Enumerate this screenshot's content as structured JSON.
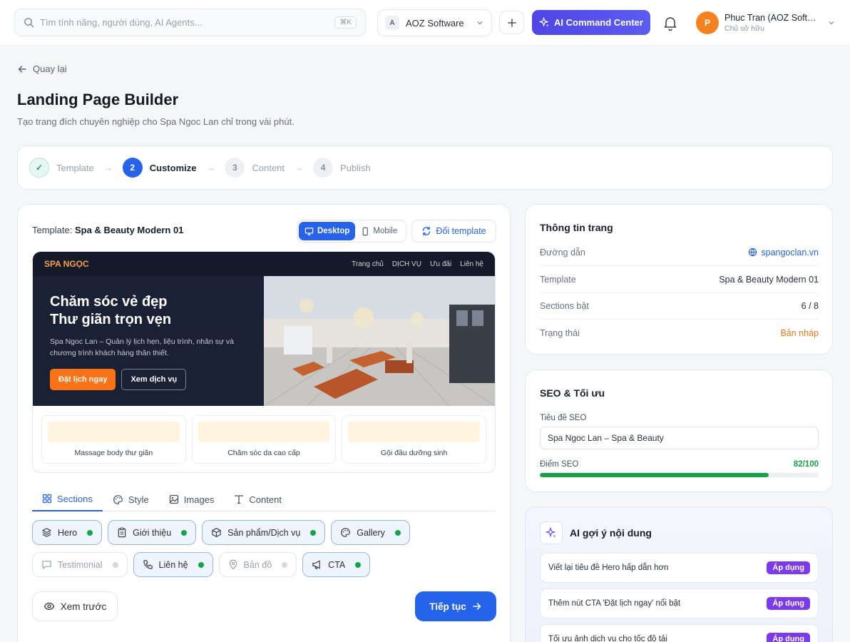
{
  "topbar": {
    "search_placeholder": "Tìm tính năng, người dùng, AI Agents...",
    "search_shortcut": "⌘K",
    "org_mark": "A",
    "org_name": "AOZ Software",
    "ai_button": "AI Command Center",
    "user_initial": "P",
    "user_name": "Phuc Tran (AOZ Software)",
    "user_role": "Chủ sở hữu"
  },
  "header": {
    "back": "Quay lại",
    "title": "Landing Page Builder",
    "subtitle": "Tạo trang đích chuyên nghiệp cho Spa Ngoc Lan chỉ trong vài phút."
  },
  "stepper": [
    {
      "num": "✓",
      "label": "Template",
      "state": "done"
    },
    {
      "num": "2",
      "label": "Customize",
      "state": "active"
    },
    {
      "num": "3",
      "label": "Content",
      "state": "todo"
    },
    {
      "num": "4",
      "label": "Publish",
      "state": "todo"
    }
  ],
  "builder": {
    "template_prefix": "Template:",
    "template_name": "Spa & Beauty Modern 01",
    "device_desktop": "Desktop",
    "device_mobile": "Mobile",
    "swap_template": "Đổi template",
    "preview": {
      "brand": "SPA NGỌC",
      "nav": [
        "Trang chủ",
        "DỊCH VỤ",
        "Ưu đãi",
        "Liên hệ"
      ],
      "hero_title_1": "Chăm sóc vẻ đẹp",
      "hero_title_2": "Thư giãn trọn vẹn",
      "hero_desc": "Spa Ngoc Lan – Quản lý lịch hẹn, liệu trình, nhân sự và chương trình khách hàng thân thiết.",
      "btn_primary": "Đặt lịch ngay",
      "btn_secondary": "Xem dịch vụ",
      "cards": [
        "Massage body thư giãn",
        "Chăm sóc da cao cấp",
        "Gội đầu dưỡng sinh"
      ]
    },
    "tabs": [
      "Sections",
      "Style",
      "Images",
      "Content"
    ],
    "sections_row1": [
      {
        "label": "Hero",
        "icon": "layers-icon",
        "on": true
      },
      {
        "label": "Giới thiệu",
        "icon": "clipboard-icon",
        "on": true
      },
      {
        "label": "Sản phẩm/Dịch vụ",
        "icon": "box-icon",
        "on": true
      },
      {
        "label": "Gallery",
        "icon": "palette-icon",
        "on": true
      }
    ],
    "sections_row2": [
      {
        "label": "Testimonial",
        "icon": "message-icon",
        "on": false
      },
      {
        "label": "Liên hệ",
        "icon": "phone-icon",
        "on": true
      },
      {
        "label": "Bản đồ",
        "icon": "map-pin-icon",
        "on": false
      },
      {
        "label": "CTA",
        "icon": "megaphone-icon",
        "on": true
      }
    ],
    "preview_button": "Xem trước",
    "next_button": "Tiếp tục"
  },
  "page_info": {
    "title": "Thông tin trang",
    "rows": [
      {
        "label": "Đường dẫn",
        "value": "spangoclan.vn"
      },
      {
        "label": "Template",
        "value": "Spa & Beauty Modern 01"
      },
      {
        "label": "Sections bật",
        "value": "6 / 8"
      },
      {
        "label": "Trạng thái",
        "value": "Bản nháp"
      }
    ]
  },
  "seo": {
    "title": "SEO & Tối ưu",
    "field_label": "Tiêu đề SEO",
    "field_value": "Spa Ngoc Lan – Spa & Beauty",
    "score_label": "Điểm SEO",
    "score_text": "82/100",
    "score_value": 82,
    "score_max": 100
  },
  "ai_suggest": {
    "title": "AI gợi ý nội dung",
    "apply_label": "Áp dụng",
    "items": [
      "Viết lại tiêu đề Hero hấp dẫn hơn",
      "Thêm nút CTA 'Đặt lịch ngay' nổi bật",
      "Tối ưu ảnh dịch vụ cho tốc độ tải"
    ]
  },
  "colors": {
    "primary": "#2563eb",
    "accent": "#f97316",
    "success": "#16a34a",
    "ai": "#7c3aed"
  }
}
